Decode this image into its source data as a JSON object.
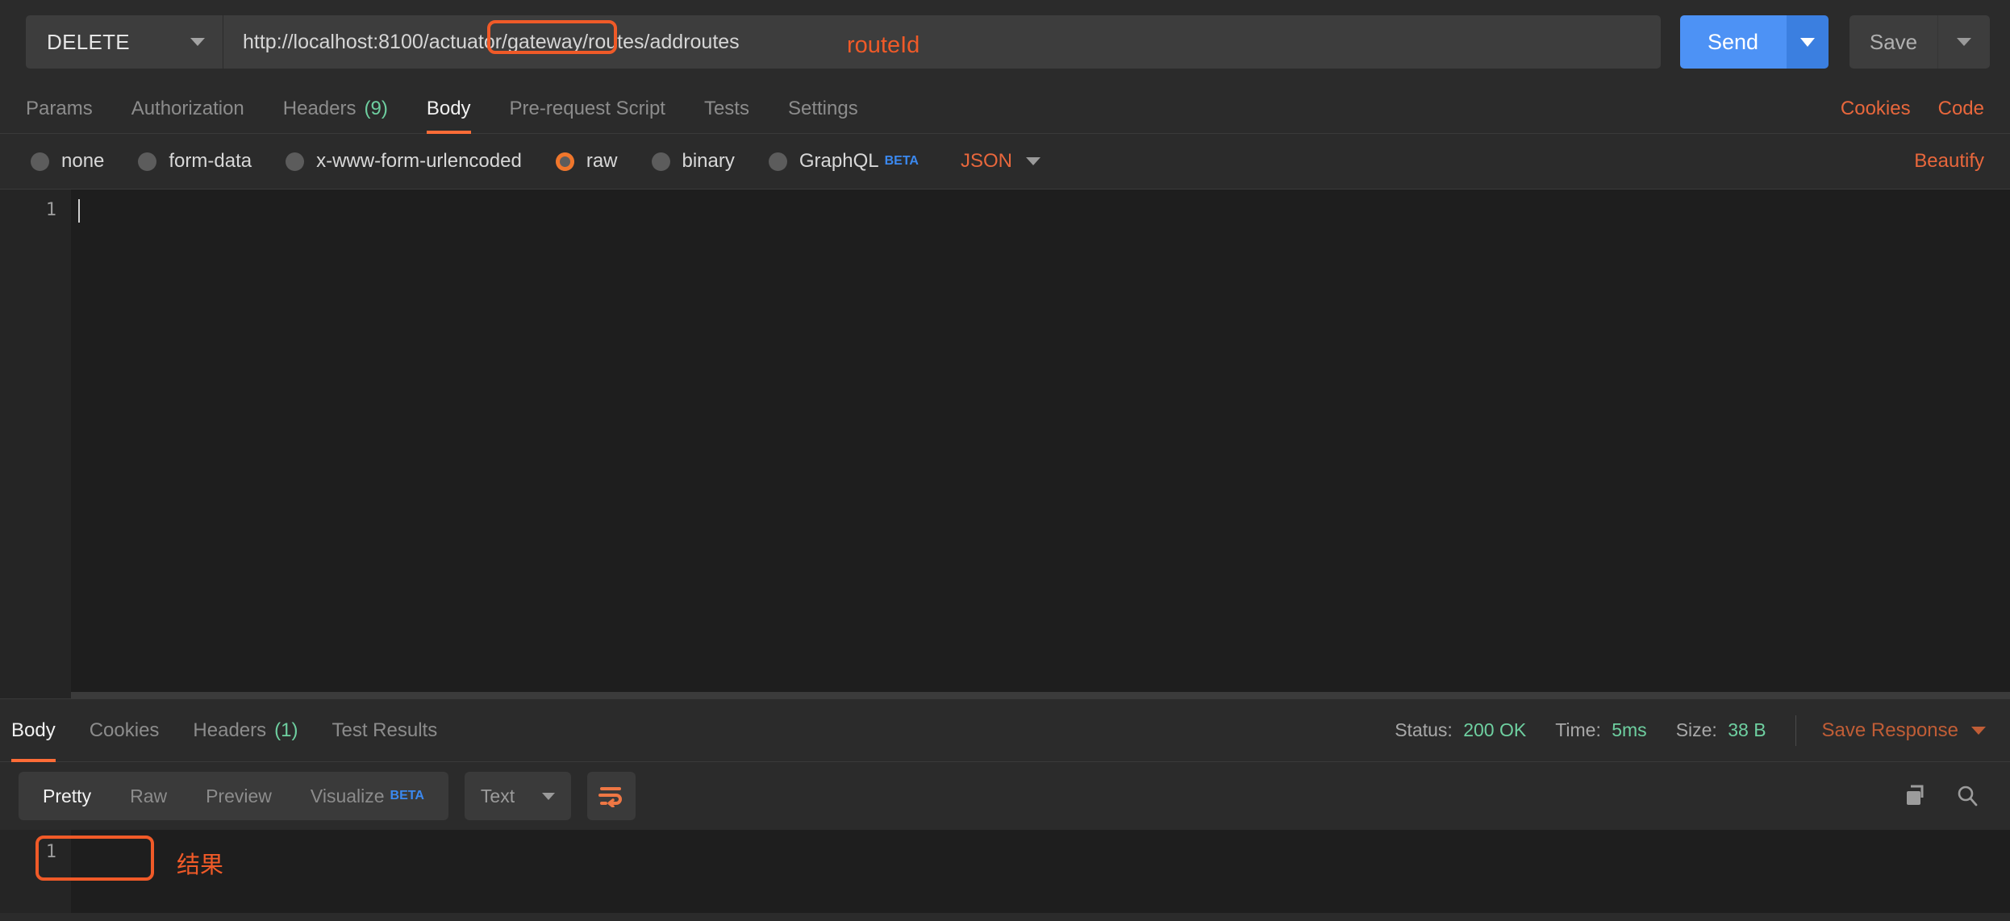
{
  "request": {
    "method": "DELETE",
    "url_prefix": "http://localhost:8100/actuator/gateway/routes",
    "url_highlight": "/addroutes",
    "url_full": "http://localhost:8100/actuator/gateway/routes/addroutes",
    "send_label": "Send",
    "save_label": "Save"
  },
  "annotations": {
    "route_id": "routeId",
    "result": "结果"
  },
  "request_tabs": [
    {
      "label": "Params",
      "count": "",
      "active": false
    },
    {
      "label": "Authorization",
      "count": "",
      "active": false
    },
    {
      "label": "Headers",
      "count": "(9)",
      "active": false
    },
    {
      "label": "Body",
      "count": "",
      "active": true
    },
    {
      "label": "Pre-request Script",
      "count": "",
      "active": false
    },
    {
      "label": "Tests",
      "count": "",
      "active": false
    },
    {
      "label": "Settings",
      "count": "",
      "active": false
    }
  ],
  "request_tabs_right": [
    {
      "label": "Cookies"
    },
    {
      "label": "Code"
    }
  ],
  "body_types": [
    {
      "label": "none",
      "selected": false,
      "beta": ""
    },
    {
      "label": "form-data",
      "selected": false,
      "beta": ""
    },
    {
      "label": "x-www-form-urlencoded",
      "selected": false,
      "beta": ""
    },
    {
      "label": "raw",
      "selected": true,
      "beta": ""
    },
    {
      "label": "binary",
      "selected": false,
      "beta": ""
    },
    {
      "label": "GraphQL",
      "selected": false,
      "beta": "BETA"
    }
  ],
  "body_format": {
    "selected": "JSON",
    "beautify_label": "Beautify"
  },
  "request_editor": {
    "lines": [
      "1"
    ],
    "content": ""
  },
  "response_tabs": [
    {
      "label": "Body",
      "count": "",
      "active": true
    },
    {
      "label": "Cookies",
      "count": "",
      "active": false
    },
    {
      "label": "Headers",
      "count": "(1)",
      "active": false
    },
    {
      "label": "Test Results",
      "count": "",
      "active": false
    }
  ],
  "response_meta": {
    "status_key": "Status:",
    "status_value": "200 OK",
    "time_key": "Time:",
    "time_value": "5ms",
    "size_key": "Size:",
    "size_value": "38 B",
    "save_response_label": "Save Response"
  },
  "response_toolbar": {
    "formats": [
      {
        "label": "Pretty",
        "active": true,
        "beta": ""
      },
      {
        "label": "Raw",
        "active": false,
        "beta": ""
      },
      {
        "label": "Preview",
        "active": false,
        "beta": ""
      },
      {
        "label": "Visualize",
        "active": false,
        "beta": "BETA"
      }
    ],
    "content_type": "Text",
    "wrap_icon": "word-wrap-icon",
    "copy_icon": "copy-icon",
    "search_icon": "search-icon"
  },
  "response_body": {
    "lines": [
      "1"
    ],
    "content": ""
  },
  "colors": {
    "accent_orange": "#FF6C37",
    "annotation_red": "#F05A28",
    "send_blue": "#4D92F5",
    "status_green": "#6ECFA0",
    "beta_blue": "#3B89F0",
    "panel_bg": "#2B2B2B",
    "editor_bg": "#1E1E1E"
  }
}
